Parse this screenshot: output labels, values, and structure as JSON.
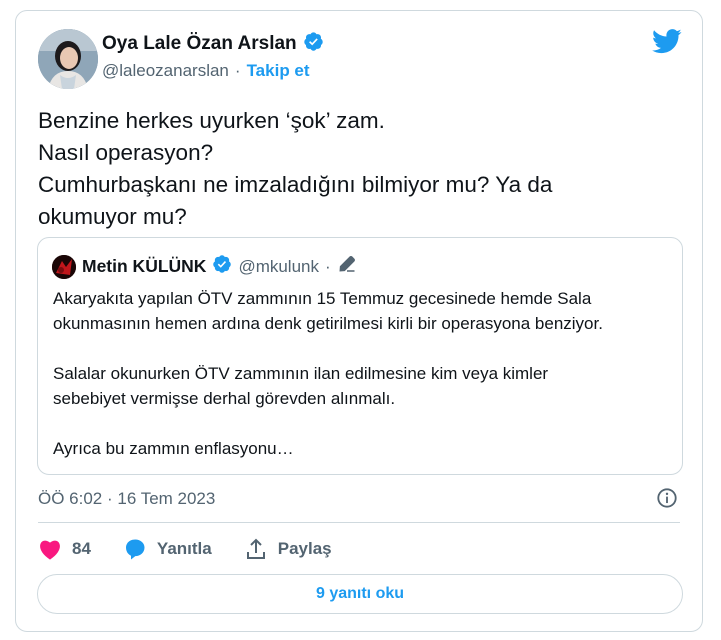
{
  "author": {
    "name": "Oya Lale Özan Arslan",
    "handle": "@laleozanarslan",
    "separator": "·",
    "follow_label": "Takip et"
  },
  "tweet_lines": [
    "Benzine herkes uyurken ‘şok’ zam.",
    "Nasıl operasyon?",
    "Cumhurbaşkanı ne imzaladığını bilmiyor mu? Ya da",
    "okumuyor mu?"
  ],
  "quote": {
    "name": "Metin KÜLÜNK",
    "handle": "@mkulunk",
    "separator": "·",
    "lines": [
      "Akaryakıta yapılan ÖTV zammının 15 Temmuz gecesinede hemde Sala",
      "okunmasının hemen ardına denk getirilmesi kirli bir operasyona benziyor.",
      "",
      "Salalar okunurken ÖTV zammının ilan edilmesine kim veya kimler",
      "sebebiyet vermişse derhal görevden alınmalı.",
      "",
      "Ayrıca bu zammın enflasyonu…"
    ]
  },
  "meta": {
    "timestamp": "ÖÖ 6:02 · 16 Tem 2023"
  },
  "actions": {
    "like_count": "84",
    "reply_label": "Yanıtla",
    "share_label": "Paylaş"
  },
  "read_replies_label": "9 yanıtı oku",
  "colors": {
    "accent": "#1d9bf0",
    "like": "#f91880",
    "text": "#0f1419",
    "secondary": "#536471",
    "border": "#cfd9de"
  },
  "icons": [
    "twitter-bird-icon",
    "verified-badge-icon",
    "edit-pencil-icon",
    "info-icon",
    "heart-icon",
    "reply-bubble-icon",
    "share-icon"
  ]
}
